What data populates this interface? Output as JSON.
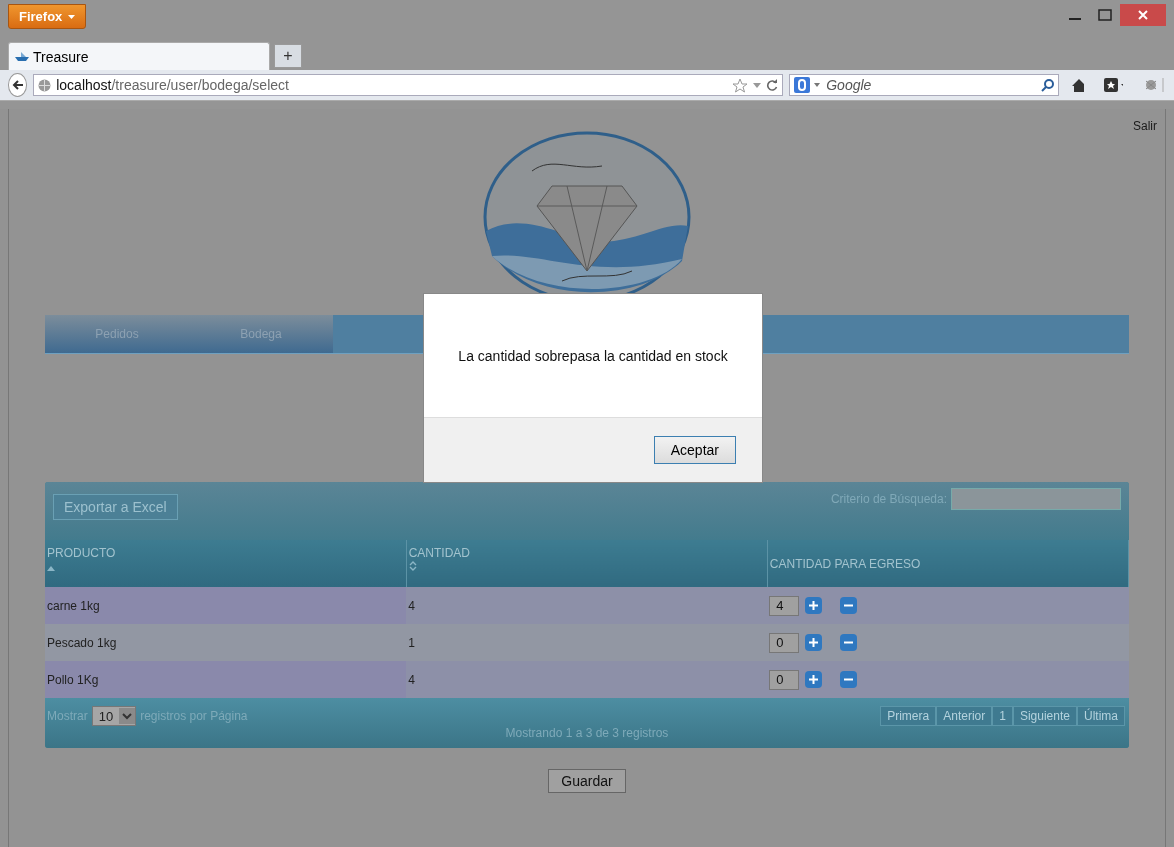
{
  "browser": {
    "menu_button": "Firefox",
    "tab": {
      "title": "Treasure",
      "selected": true
    },
    "new_tab": "+",
    "url": {
      "host": "localhost",
      "path": "/treasure/user/bodega/select"
    },
    "search": {
      "placeholder": "Google"
    }
  },
  "page": {
    "logout": "Salir",
    "nav": [
      {
        "label": "Pedidos"
      },
      {
        "label": "Bodega"
      }
    ],
    "table": {
      "export_button": "Exportar a Excel",
      "search_label": "Criterio de Búsqueda:",
      "columns": [
        {
          "label": "PRODUCTO",
          "kind": "sortable",
          "sorted": true
        },
        {
          "label": "CANTIDAD",
          "kind": "sortable",
          "sorted": false
        },
        {
          "label": "CANTIDAD PARA EGRESO",
          "kind": "plain",
          "sorted": false
        }
      ],
      "rows": [
        {
          "producto": "carne 1kg",
          "cantidad": "4",
          "egreso": "4"
        },
        {
          "producto": "Pescado 1kg",
          "cantidad": "1",
          "egreso": "0"
        },
        {
          "producto": "Pollo 1Kg",
          "cantidad": "4",
          "egreso": "0"
        }
      ],
      "footer": {
        "show_label": "Mostrar",
        "page_size": "10",
        "per_page_label": "registros por Página",
        "info": "Mostrando 1 a 3 de 3 registros",
        "pagination": [
          "Primera",
          "Anterior",
          "1",
          "Siguiente",
          "Última"
        ]
      }
    },
    "save_button": "Guardar"
  },
  "dialog": {
    "message": "La cantidad sobrepasa la cantidad en stock",
    "button": "Aceptar"
  }
}
